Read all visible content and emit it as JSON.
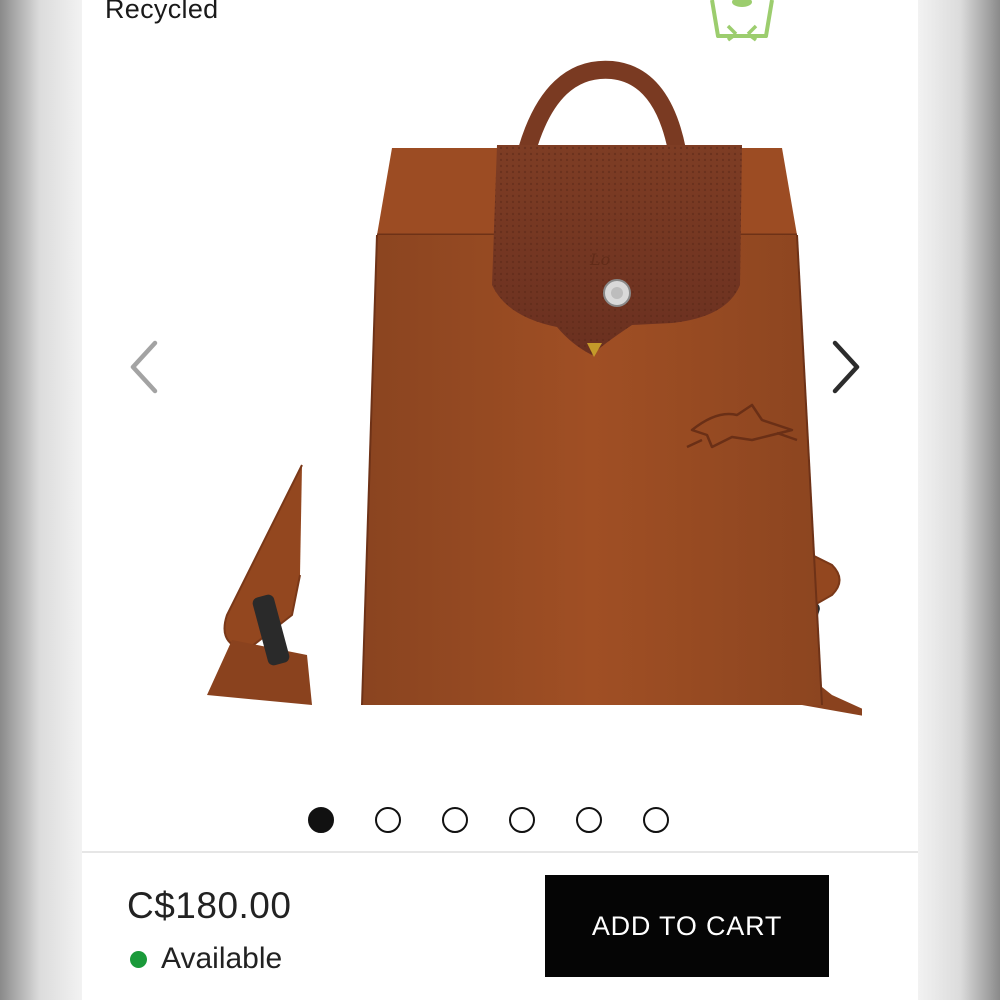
{
  "header": {
    "material_label": "Recycled",
    "recycle_icon": "recycle-icon",
    "recycle_icon_color": "#9ccd6e"
  },
  "gallery": {
    "image": "product-backpack-image",
    "prev_icon": "chevron-left-icon",
    "next_icon": "chevron-right-icon",
    "page_count": 6,
    "active_page": 1
  },
  "purchase": {
    "price": "C$180.00",
    "availability": "Available",
    "availability_color": "#1a9a3a",
    "add_to_cart_label": "ADD TO CART"
  },
  "colors": {
    "bag": "#9a4b22",
    "leather": "#7a3a22",
    "button": "#050505"
  }
}
